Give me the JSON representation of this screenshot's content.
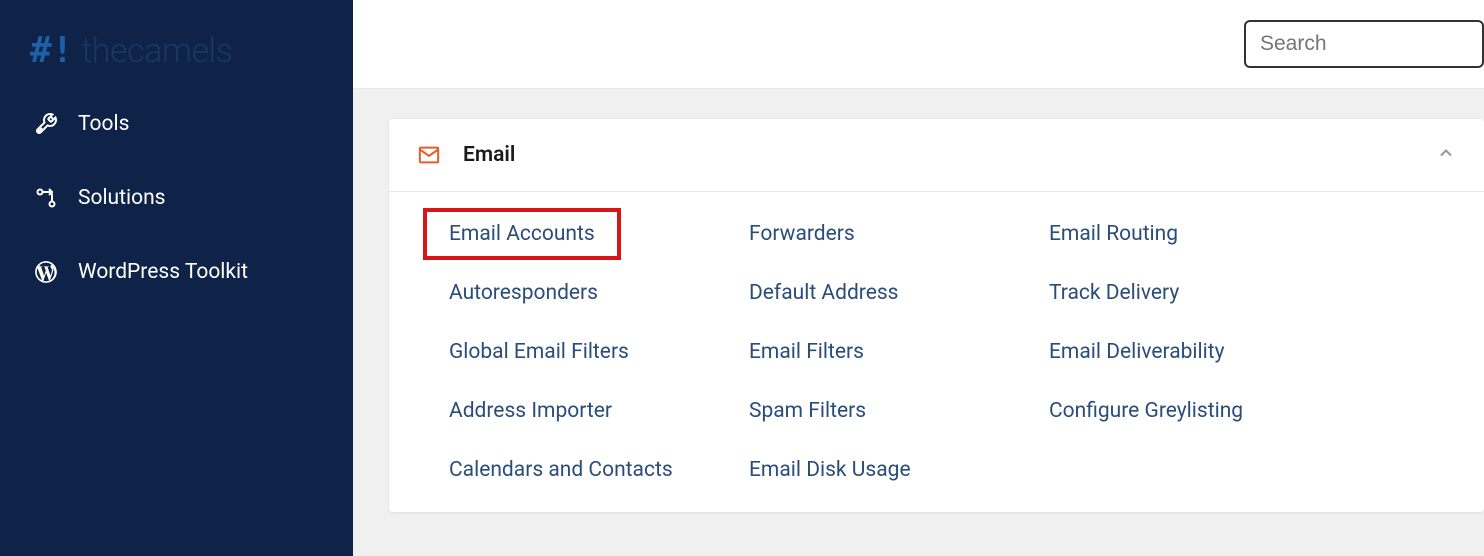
{
  "sidebar": {
    "logo_mark": "#!",
    "logo_text": "thecamels",
    "items": [
      {
        "label": "Tools"
      },
      {
        "label": "Solutions"
      },
      {
        "label": "WordPress Toolkit"
      }
    ]
  },
  "search": {
    "placeholder": "Search"
  },
  "panel": {
    "title": "Email",
    "links": [
      "Email Accounts",
      "Forwarders",
      "Email Routing",
      "Autoresponders",
      "Default Address",
      "Track Delivery",
      "Global Email Filters",
      "Email Filters",
      "Email Deliverability",
      "Address Importer",
      "Spam Filters",
      "Configure Greylisting",
      "Calendars and Contacts",
      "Email Disk Usage"
    ]
  }
}
